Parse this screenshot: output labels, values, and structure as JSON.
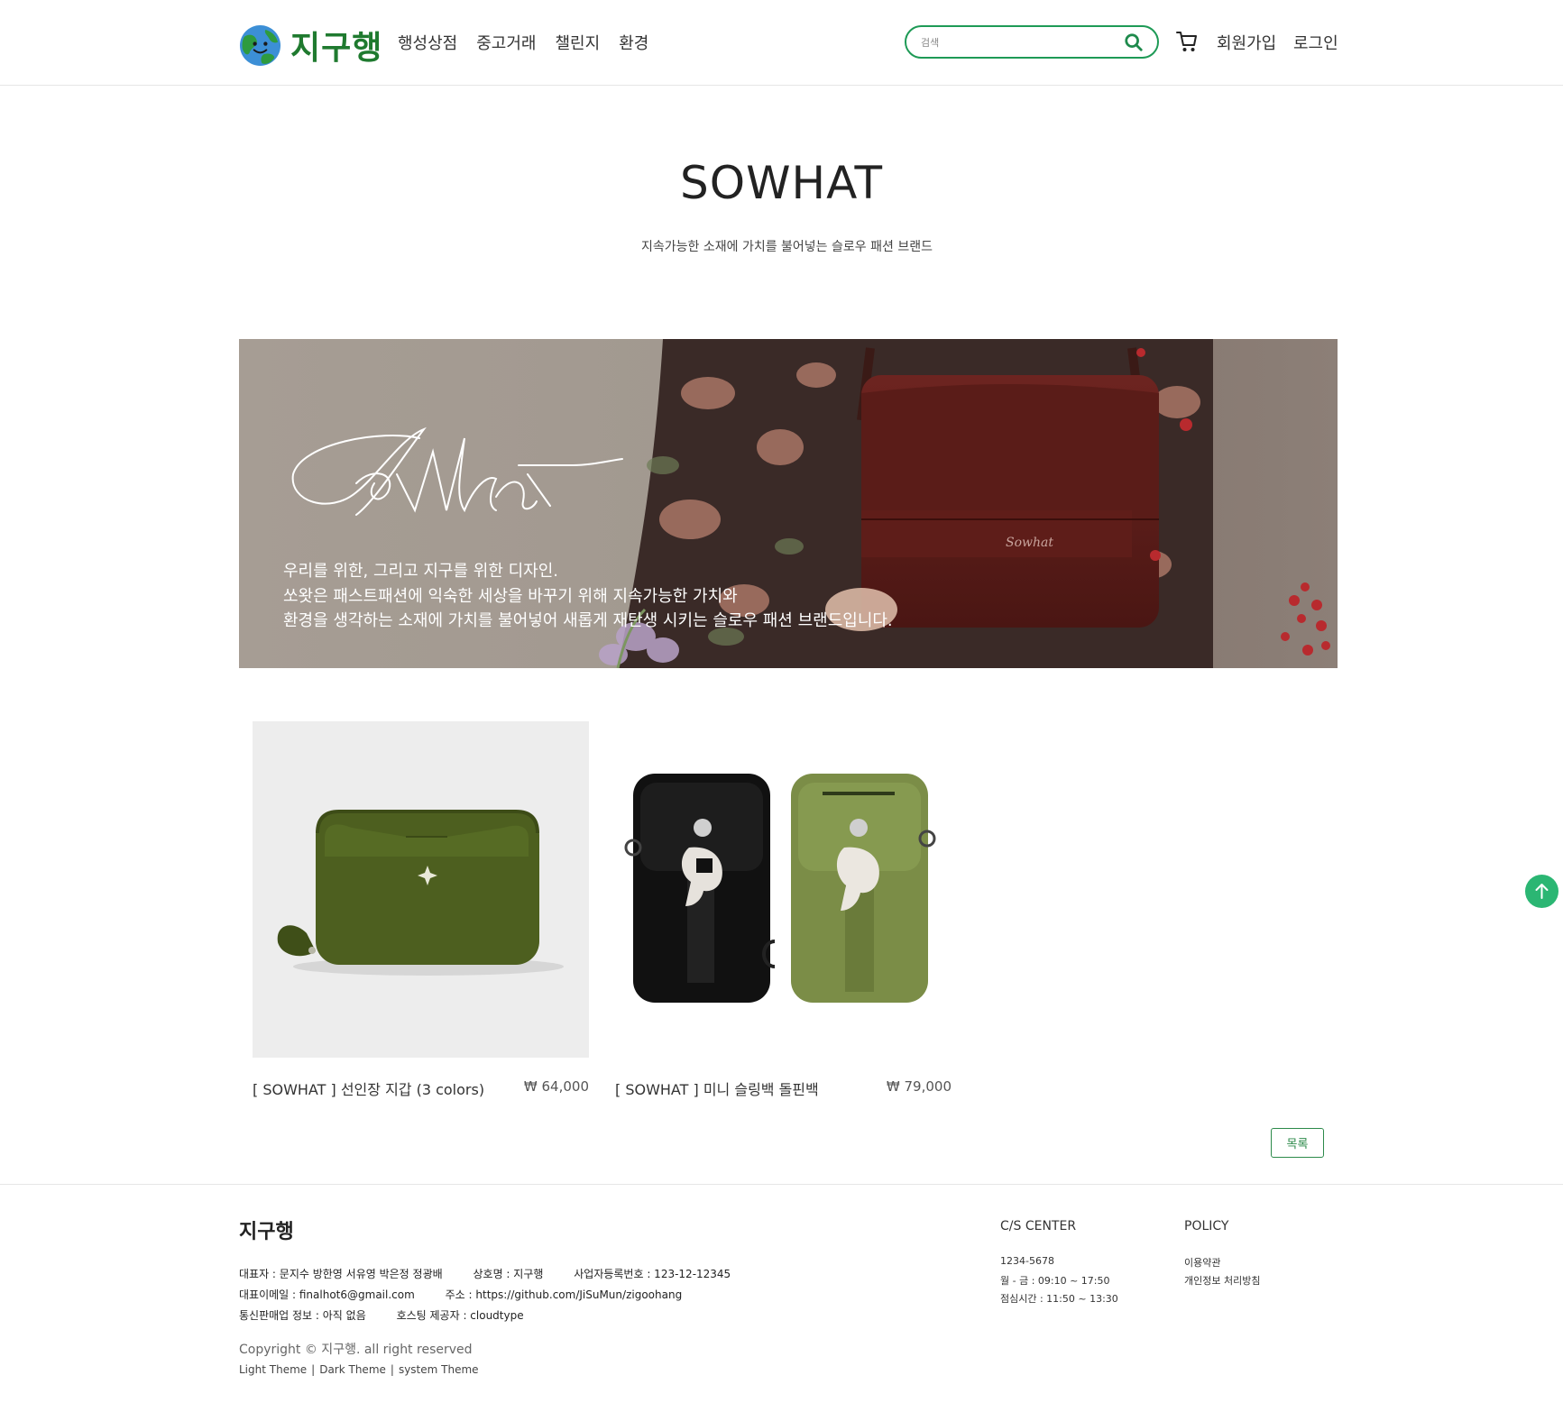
{
  "header": {
    "logo_text": "지구행",
    "nav": [
      "행성상점",
      "중고거래",
      "챌린지",
      "환경"
    ],
    "search_placeholder": "검색",
    "signup": "회원가입",
    "login": "로그인"
  },
  "brand": {
    "title": "SOWHAT",
    "subtitle": "지속가능한 소재에 가치를 불어넣는 슬로우 패션 브랜드"
  },
  "banner": {
    "signature": "SoWhat",
    "lines": [
      "우리를 위한, 그리고 지구를 위한 디자인.",
      "쏘왓은 패스트패션에 익숙한 세상을 바꾸기 위해 지속가능한 가치와",
      "환경을 생각하는 소재에 가치를 불어넣어 새롭게 재탄생 시키는 슬로우 패션 브랜드입니다."
    ]
  },
  "products": [
    {
      "name": "[ SOWHAT ] 선인장 지갑 (3 colors)",
      "price": "₩ 64,000"
    },
    {
      "name": "[ SOWHAT ] 미니 슬링백 돌핀백",
      "price": "₩ 79,000"
    }
  ],
  "list_button": "목록",
  "footer": {
    "brand": "지구행",
    "info_rows": [
      [
        "대표자 : 문지수 방한영 서유영 박은정 정광배",
        "상호명 : 지구행",
        "사업자등록번호 : 123-12-12345"
      ],
      [
        "대표이메일 : finalhot6@gmail.com",
        "주소 : https://github.com/JiSuMun/zigoohang"
      ],
      [
        "통신판매업 정보 : 아직 없음",
        "호스팅 제공자 : cloudtype"
      ]
    ],
    "copyright": "Copyright © 지구행. all right reserved",
    "themes": [
      "Light Theme",
      "Dark Theme",
      "system Theme"
    ],
    "cs_title": "C/S CENTER",
    "cs_items": [
      "1234-5678",
      "월 - 금 : 09:10 ~ 17:50",
      "점심시간 : 11:50 ~ 13:30"
    ],
    "policy_title": "POLICY",
    "policy_items": [
      "이용약관",
      "개인정보 처리방침"
    ]
  },
  "colors": {
    "brand_green": "#1f7a2f",
    "accent_green": "#1e9a56",
    "top_button": "#2bb673"
  }
}
